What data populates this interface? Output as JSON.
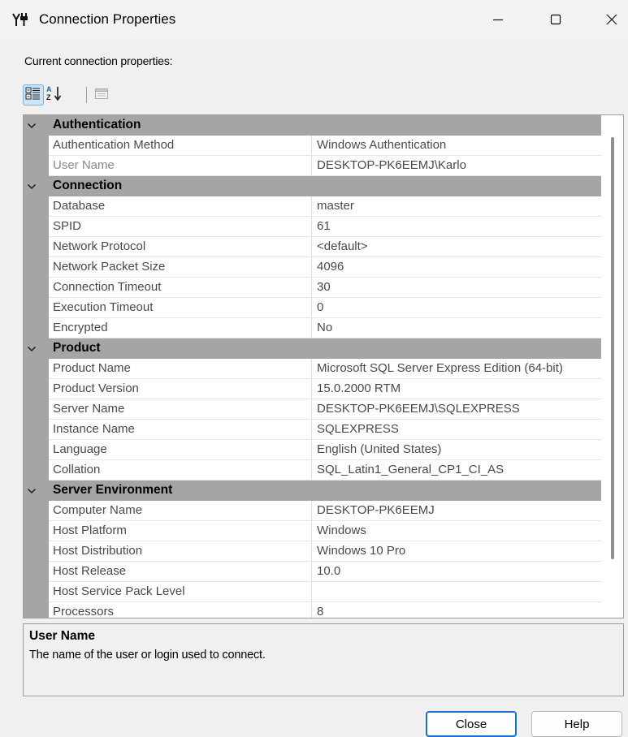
{
  "window": {
    "title": "Connection Properties",
    "icons": {
      "app": "plug-icon",
      "minimize": "minimize-icon",
      "maximize": "maximize-icon",
      "close": "close-icon"
    }
  },
  "current_label": "Current connection properties:",
  "toolbar": {
    "icons": [
      "categorized-icon",
      "sort-alpha-icon",
      "property-pages-icon"
    ]
  },
  "categories": [
    {
      "name": "Authentication",
      "properties": [
        {
          "name": "Authentication Method",
          "value": "Windows Authentication"
        },
        {
          "name": "User Name",
          "value": "DESKTOP-PK6EEMJ\\Karlo",
          "selected": true
        }
      ]
    },
    {
      "name": "Connection",
      "properties": [
        {
          "name": "Database",
          "value": "master"
        },
        {
          "name": "SPID",
          "value": "61"
        },
        {
          "name": "Network Protocol",
          "value": "<default>"
        },
        {
          "name": "Network Packet Size",
          "value": "4096"
        },
        {
          "name": "Connection Timeout",
          "value": "30"
        },
        {
          "name": "Execution Timeout",
          "value": "0"
        },
        {
          "name": "Encrypted",
          "value": "No"
        }
      ]
    },
    {
      "name": "Product",
      "properties": [
        {
          "name": "Product Name",
          "value": "Microsoft SQL Server Express Edition (64-bit)"
        },
        {
          "name": "Product Version",
          "value": "15.0.2000 RTM"
        },
        {
          "name": "Server Name",
          "value": "DESKTOP-PK6EEMJ\\SQLEXPRESS"
        },
        {
          "name": "Instance Name",
          "value": "SQLEXPRESS"
        },
        {
          "name": "Language",
          "value": "English (United States)"
        },
        {
          "name": "Collation",
          "value": "SQL_Latin1_General_CP1_CI_AS"
        }
      ]
    },
    {
      "name": "Server Environment",
      "properties": [
        {
          "name": "Computer Name",
          "value": "DESKTOP-PK6EEMJ"
        },
        {
          "name": "Host Platform",
          "value": "Windows"
        },
        {
          "name": "Host Distribution",
          "value": "Windows 10 Pro"
        },
        {
          "name": "Host Release",
          "value": "10.0"
        },
        {
          "name": "Host Service Pack Level",
          "value": ""
        },
        {
          "name": "Processors",
          "value": "8"
        }
      ]
    }
  ],
  "description": {
    "title": "User Name",
    "text": "The name of the user or login used to connect."
  },
  "buttons": {
    "close_label": "Close",
    "help_label": "Help"
  },
  "colors": {
    "category_band": "#a5a5a5",
    "default_button_border": "#1a6fd1",
    "toolbar_active": "#cde4f7"
  }
}
